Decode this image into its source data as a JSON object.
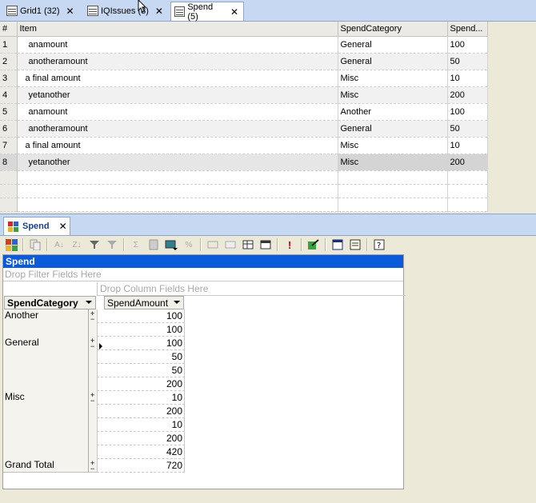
{
  "tabs": [
    {
      "label": "Grid1 (32)",
      "close": "✕"
    },
    {
      "label": "IQIssues (8)",
      "close": "✕"
    },
    {
      "label": "Spend (5)",
      "close": "✕"
    }
  ],
  "grid": {
    "columns": [
      "#",
      "Item",
      "SpendCategory",
      "Spend..."
    ],
    "rows": [
      {
        "n": "1",
        "item": "anamount",
        "cat": "General",
        "amt": "100"
      },
      {
        "n": "2",
        "item": "anotheramount",
        "cat": "General",
        "amt": "50"
      },
      {
        "n": "3",
        "item": "a final amount",
        "cat": "Misc",
        "amt": "10"
      },
      {
        "n": "4",
        "item": "yetanother",
        "cat": "Misc",
        "amt": "200"
      },
      {
        "n": "5",
        "item": "anamount",
        "cat": "Another",
        "amt": "100"
      },
      {
        "n": "6",
        "item": "anotheramount",
        "cat": "General",
        "amt": "50"
      },
      {
        "n": "7",
        "item": "a final amount",
        "cat": "Misc",
        "amt": "10"
      },
      {
        "n": "8",
        "item": "yetanother",
        "cat": "Misc",
        "amt": "200"
      }
    ]
  },
  "panel": {
    "tab_label": "Spend",
    "tab_close": "✕",
    "pivot_title": "Spend",
    "drop_filter": "Drop Filter Fields Here",
    "drop_column": "Drop Column Fields Here",
    "row_field": "SpendCategory",
    "data_field": "SpendAmount",
    "groups": [
      {
        "label": "Another",
        "values": [
          "100"
        ],
        "total": "100"
      },
      {
        "label": "General",
        "values": [
          "100",
          "50",
          "50"
        ],
        "total": "200"
      },
      {
        "label": "Misc",
        "values": [
          "10",
          "200",
          "10",
          "200"
        ],
        "total": "420"
      }
    ],
    "grand_total_label": "Grand Total",
    "grand_total": "720",
    "plus": "+",
    "minus": "−"
  },
  "toolbar_icons": [
    "layout-icon",
    "copy-icon",
    "sort-asc-icon",
    "sort-desc-icon",
    "filter-icon",
    "filter-clear-icon",
    "sum-icon",
    "calc-icon",
    "chart-icon",
    "percent-icon",
    "insert-col-icon",
    "delete-col-icon",
    "grid-icon",
    "table-icon",
    "alert-icon",
    "export-icon",
    "window-icon",
    "list-icon",
    "help-icon"
  ]
}
